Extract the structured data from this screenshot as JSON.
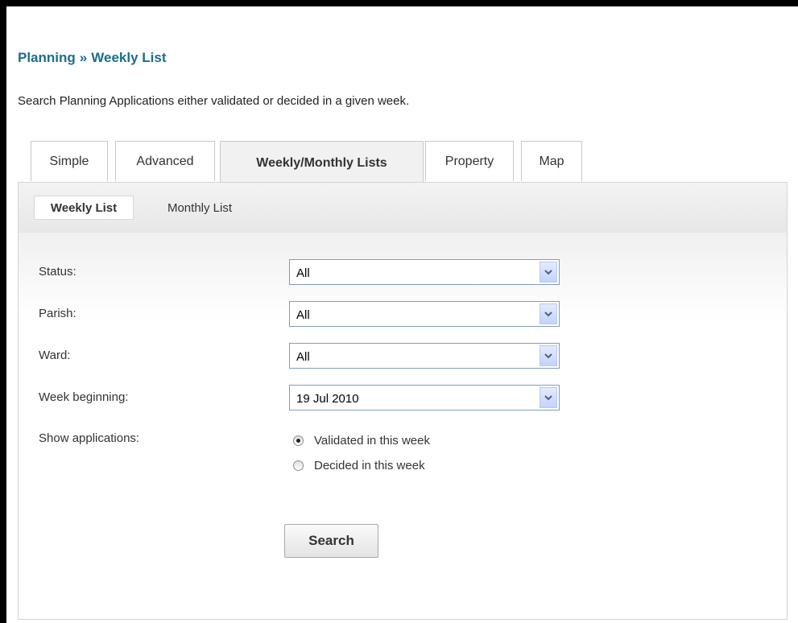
{
  "header": {
    "breadcrumb_parent": "Planning",
    "breadcrumb_separator": "»",
    "breadcrumb_current": "Weekly List",
    "description": "Search Planning Applications either validated or decided in a given week."
  },
  "tabs": [
    {
      "label": "Simple",
      "active": false
    },
    {
      "label": "Advanced",
      "active": false
    },
    {
      "label": "Weekly/Monthly Lists",
      "active": true
    },
    {
      "label": "Property",
      "active": false
    },
    {
      "label": "Map",
      "active": false
    }
  ],
  "subtabs": [
    {
      "label": "Weekly List",
      "active": true
    },
    {
      "label": "Monthly List",
      "active": false
    }
  ],
  "form": {
    "status": {
      "label": "Status:",
      "value": "All"
    },
    "parish": {
      "label": "Parish:",
      "value": "All"
    },
    "ward": {
      "label": "Ward:",
      "value": "All"
    },
    "week_beginning": {
      "label": "Week beginning:",
      "value": "19 Jul 2010"
    },
    "show_applications": {
      "label": "Show applications:",
      "options": [
        {
          "label": "Validated in this week",
          "checked": true
        },
        {
          "label": "Decided in this week",
          "checked": false
        }
      ]
    },
    "search_label": "Search"
  },
  "icons": {
    "dropdown": "chevron-down-icon",
    "radio": "radio-button"
  },
  "colors": {
    "title": "#1a6e8a",
    "select_border": "#7f9db9",
    "chevron": "#4d6185"
  }
}
